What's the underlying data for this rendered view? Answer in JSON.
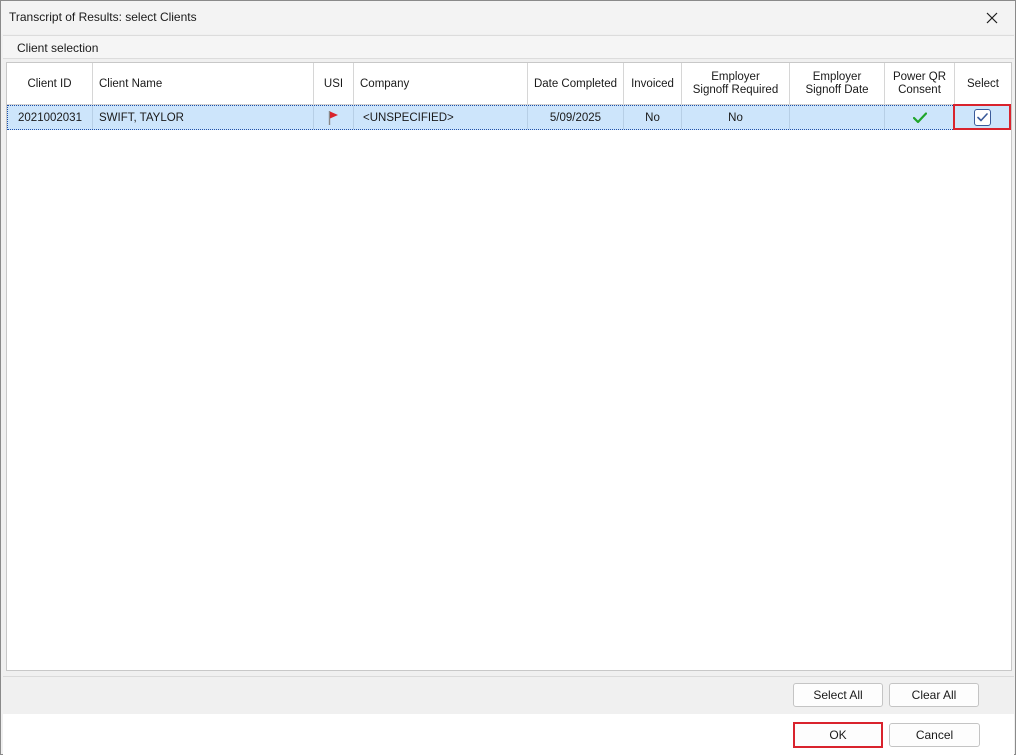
{
  "window": {
    "title": "Transcript of Results: select Clients"
  },
  "group": {
    "label": "Client selection"
  },
  "grid": {
    "columns": [
      {
        "key": "client_id",
        "label": "Client ID"
      },
      {
        "key": "client_name",
        "label": "Client Name"
      },
      {
        "key": "usi",
        "label": "USI"
      },
      {
        "key": "company",
        "label": "Company"
      },
      {
        "key": "date_completed",
        "label": "Date Completed"
      },
      {
        "key": "invoiced",
        "label": "Invoiced"
      },
      {
        "key": "employer_signoff_required",
        "label": "Employer\nSignoff Required"
      },
      {
        "key": "employer_signoff_date",
        "label": "Employer\nSignoff Date"
      },
      {
        "key": "power_qr_consent",
        "label": "Power QR\nConsent"
      },
      {
        "key": "select",
        "label": "Select"
      }
    ],
    "rows": [
      {
        "client_id": "2021002031",
        "client_name": "SWIFT, TAYLOR",
        "usi_icon": "red-flag-icon",
        "company": "<UNSPECIFIED>",
        "date_completed": "5/09/2025",
        "invoiced": "No",
        "employer_signoff_required": "No",
        "employer_signoff_date": "",
        "power_qr_consent_icon": "green-check-icon",
        "selected": true
      }
    ]
  },
  "buttons": {
    "select_all": "Select All",
    "clear_all": "Clear All",
    "ok": "OK",
    "cancel": "Cancel"
  },
  "colors": {
    "selected_row": "#cde5fb",
    "highlight": "#d9232d",
    "flag": "#d9232d",
    "consent_check": "#1fa52a"
  }
}
